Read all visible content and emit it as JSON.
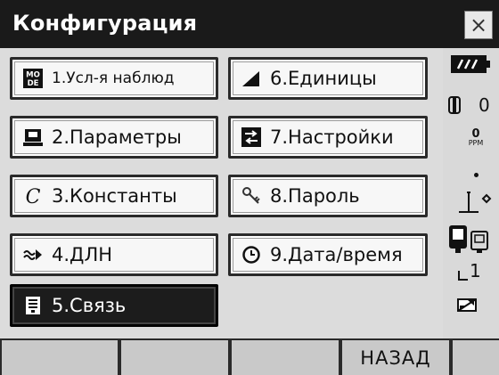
{
  "window": {
    "title": "Конфигурация",
    "close_label": "×"
  },
  "menu": [
    {
      "label": "1.Усл-я наблюд",
      "icon": "mode-icon"
    },
    {
      "label": "2.Параметры",
      "icon": "instrument-icon"
    },
    {
      "label": "3.Константы",
      "icon": "constant-c-icon"
    },
    {
      "label": "4.ДЛН",
      "icon": "edm-icon"
    },
    {
      "label": "5.Связь",
      "icon": "communication-icon",
      "selected": true
    },
    {
      "label": "6.Единицы",
      "icon": "angle-unit-icon"
    },
    {
      "label": "7.Настройки",
      "icon": "swap-icon"
    },
    {
      "label": "8.Пароль",
      "icon": "key-icon"
    },
    {
      "label": "9.Дата/время",
      "icon": "clock-icon"
    }
  ],
  "status": {
    "prism_constant": "0",
    "ppm_value": "0",
    "ppm_unit": "PPM",
    "level": "1"
  },
  "softkeys": [
    "",
    "",
    "",
    "НАЗАД",
    ""
  ]
}
